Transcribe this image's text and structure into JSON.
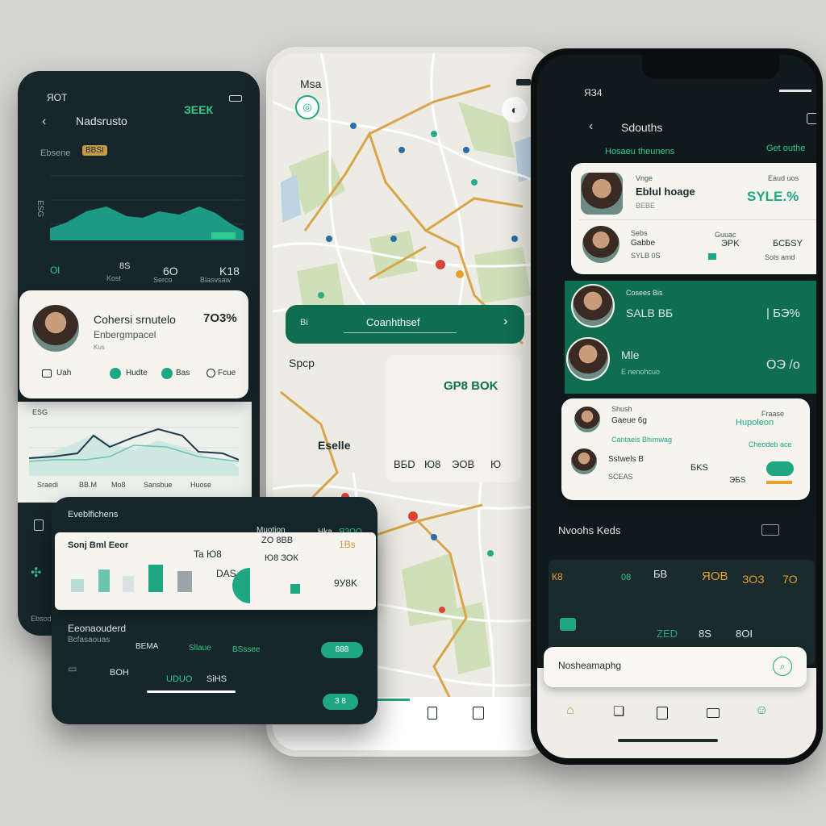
{
  "left_phone": {
    "time": "ЯОТ",
    "title": "Nadsrusto",
    "badge": "ЗЕЕК",
    "chart_label": "Ebsene",
    "chart_tag": "BBSI",
    "y_tick": "ESG",
    "stats": [
      "Ol",
      "8S",
      "6O",
      "K18"
    ],
    "stat_labels": [
      "Kost",
      "Serco",
      "Blasvsaw"
    ],
    "profile": {
      "name": "Cohersi srnutelo",
      "subtitle": "Enbergmpacel",
      "extra": "Kus",
      "value": "7О3%",
      "actions": [
        "Uah",
        "Hudte",
        "Bas",
        "Fcue"
      ]
    },
    "line_axis": [
      "Sraedi",
      "BB.M",
      "Mo8",
      "Sansbue",
      "Huose"
    ],
    "line_tag": "ESG",
    "nav_label": "Ebsodes"
  },
  "bar_card": {
    "header": "Eveblfichens",
    "tag_right": "Muotion",
    "tag_badge": "Hka",
    "tag_value": "ЯЗОО",
    "title": "Sonj Bml Eeor",
    "values": [
      "ZO 8BB",
      "Ю8 ЗОК",
      "Ta Ю8",
      "1Bs",
      "DAS",
      "9У8K"
    ],
    "footer_title": "Eeonaouderd",
    "footer_sub": "Bcfasaouas",
    "footer_items": [
      "BEMA",
      "Sllaue",
      "BSssee"
    ],
    "pill_a": "888",
    "bottom_items": [
      "BOH",
      "UDUO",
      "SiHS"
    ],
    "pill_b": "3 8"
  },
  "map_phone": {
    "title": "Msa",
    "search_value": "Coanhthsef",
    "search_icon_left": "Bi",
    "sign": "Spcp",
    "card_title": "GP8 BOK",
    "card_label": "Eselle",
    "card_values": [
      "ВБD",
      "Ю8",
      "ЭОВ",
      "Ю"
    ]
  },
  "right_phone": {
    "time": "ЯЗ4",
    "title": "Sdouths",
    "subtitle": "Hosaeu theunens",
    "subtitle_right": "Get outhe",
    "rows": [
      {
        "top": "Vnge",
        "name": "Eblul hoage",
        "sub": "ВЕВЕ",
        "right_top": "Eaud uos",
        "value": "SYLЕ.%"
      },
      {
        "top": "Sebs",
        "name": "Gabbe",
        "sub": "SYLB 0S",
        "mid": "ЭPK",
        "mid_top": "Guuac",
        "right": "БСБSY",
        "meta": "Sols amd"
      },
      {
        "top": "Cosees Bis",
        "name": "SALB ВБ",
        "value": "| БЭ%"
      },
      {
        "top": "Mle",
        "sub": "E nenohcuo",
        "value": "ОЭ /о"
      },
      {
        "top": "Shush",
        "name": "Gaeue 6g",
        "sub": "Cantaeis Bhimwag",
        "right_top": "Fraase",
        "right": "Hupoleon",
        "meta": "Cheodeb ace"
      },
      {
        "name": "Sstwels B",
        "sub": "SCEAS",
        "mid": "БKS",
        "right": "ЭБS"
      }
    ],
    "section": "Nvoohs Keds",
    "grid": [
      "К8",
      "БВ",
      "08",
      "ЯОВ",
      "ЗОЗ",
      "7О"
    ],
    "grid_sub": [
      "ZED",
      "8S",
      "8OI"
    ],
    "search_placeholder": "Nosheamaphg"
  },
  "colors": {
    "background": "#d4d5d1",
    "dark_surface": "#17262a",
    "accent_green": "#1fa784",
    "deep_green": "#0f6e52",
    "card_white": "#f5f4ef"
  }
}
